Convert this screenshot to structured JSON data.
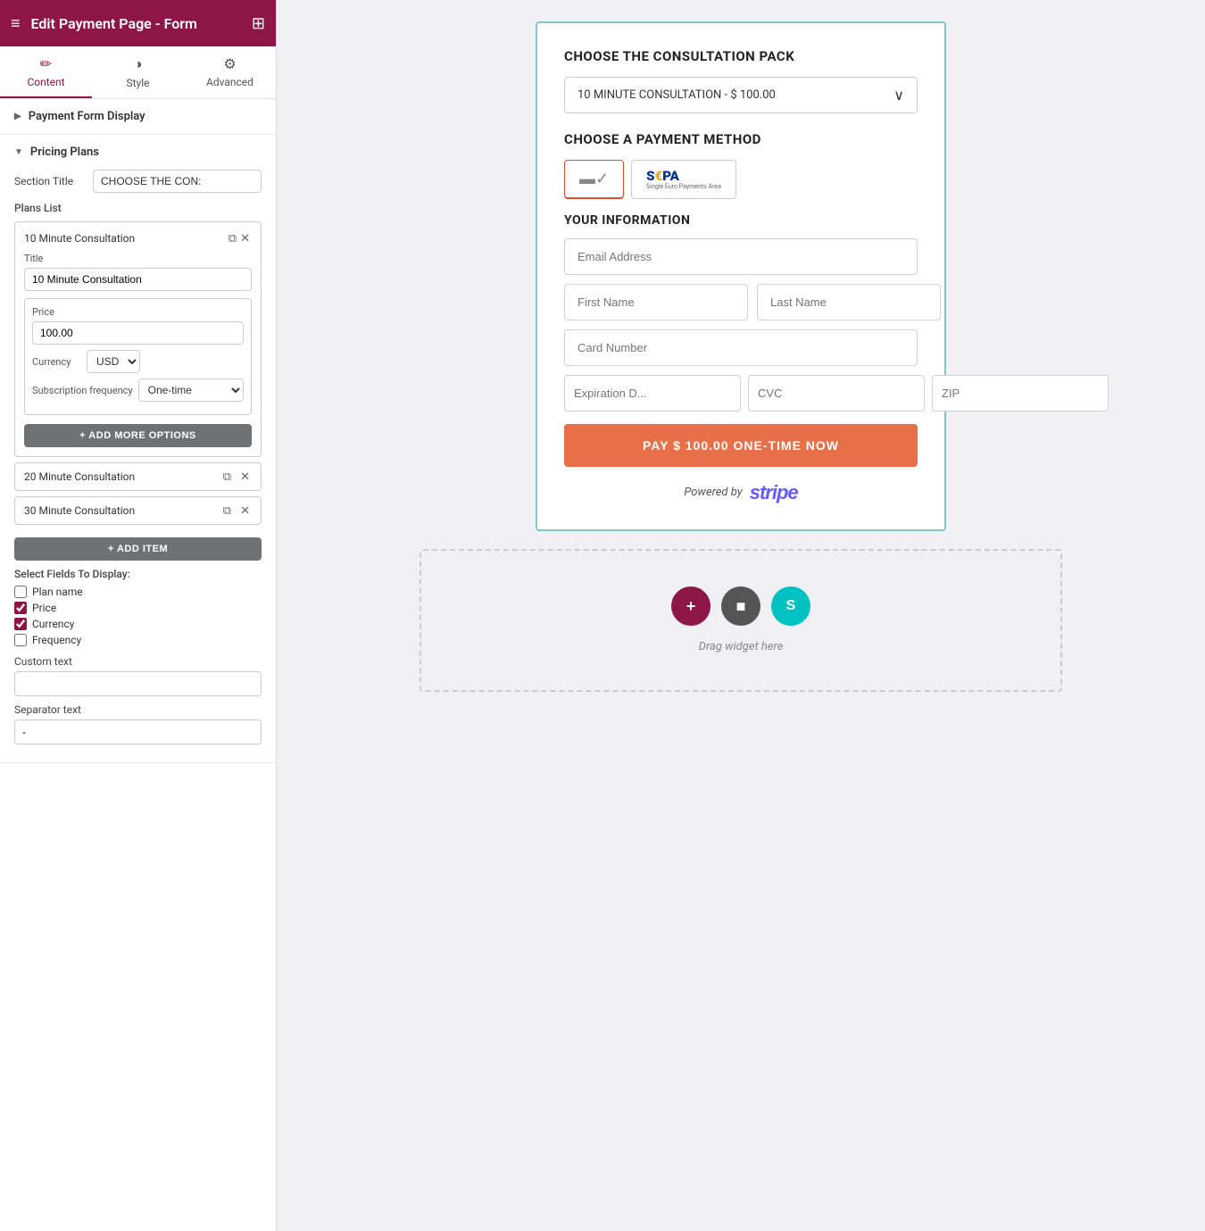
{
  "topbar": {
    "title": "Edit Payment Page - Form",
    "hamburger_icon": "≡",
    "grid_icon": "⊞"
  },
  "tabs": [
    {
      "id": "content",
      "label": "Content",
      "icon": "✏",
      "active": true
    },
    {
      "id": "style",
      "label": "Style",
      "icon": "◑",
      "active": false
    },
    {
      "id": "advanced",
      "label": "Advanced",
      "icon": "⚙",
      "active": false
    }
  ],
  "payment_form_display": {
    "label": "Payment Form Display",
    "collapsed": true
  },
  "pricing_plans": {
    "label": "Pricing Plans",
    "collapsed": false,
    "section_title_label": "Section Title",
    "section_title_value": "CHOOSE THE CON:",
    "plans_list_label": "Plans List",
    "plans": [
      {
        "id": "plan1",
        "label": "10 Minute Consultation",
        "expanded": true,
        "title_label": "Title",
        "title_value": "10 Minute Consultation",
        "price_label": "Price",
        "price_value": "100.00",
        "currency_label": "Currency",
        "currency_value": "USD",
        "freq_label": "Subscription frequency",
        "freq_value": "One-time",
        "add_options_btn": "+ ADD MORE OPTIONS"
      },
      {
        "id": "plan2",
        "label": "20 Minute Consultation",
        "expanded": false
      },
      {
        "id": "plan3",
        "label": "30 Minute Consultation",
        "expanded": false
      }
    ],
    "add_item_btn": "+ ADD ITEM",
    "select_fields_label": "Select Fields To Display:",
    "fields": [
      {
        "id": "plan_name",
        "label": "Plan name",
        "checked": false
      },
      {
        "id": "price",
        "label": "Price",
        "checked": true
      },
      {
        "id": "currency",
        "label": "Currency",
        "checked": true
      },
      {
        "id": "frequency",
        "label": "Frequency",
        "checked": false
      }
    ],
    "custom_text_label": "Custom text",
    "custom_text_value": "",
    "separator_label": "Separator text",
    "separator_value": "-"
  },
  "form_preview": {
    "choose_pack_title": "CHOOSE THE CONSULTATION PACK",
    "selected_plan": "10 MINUTE CONSULTATION - $ 100.00",
    "payment_method_title": "CHOOSE A PAYMENT METHOD",
    "card_method_label": "Card",
    "sepa_method_label": "SEPA",
    "your_info_title": "YOUR INFORMATION",
    "email_placeholder": "Email Address",
    "first_name_placeholder": "First Name",
    "last_name_placeholder": "Last Name",
    "card_number_placeholder": "Card Number",
    "expiry_placeholder": "Expiration D...",
    "cvc_placeholder": "CVC",
    "zip_placeholder": "ZIP",
    "pay_btn_label": "PAY $ 100.00 ONE-TIME NOW",
    "powered_by": "Powered by",
    "stripe_label": "stripe"
  },
  "drag_area": {
    "drag_text": "Drag widget here",
    "plus_btn": "+",
    "square_btn": "■",
    "s_btn": "S"
  }
}
